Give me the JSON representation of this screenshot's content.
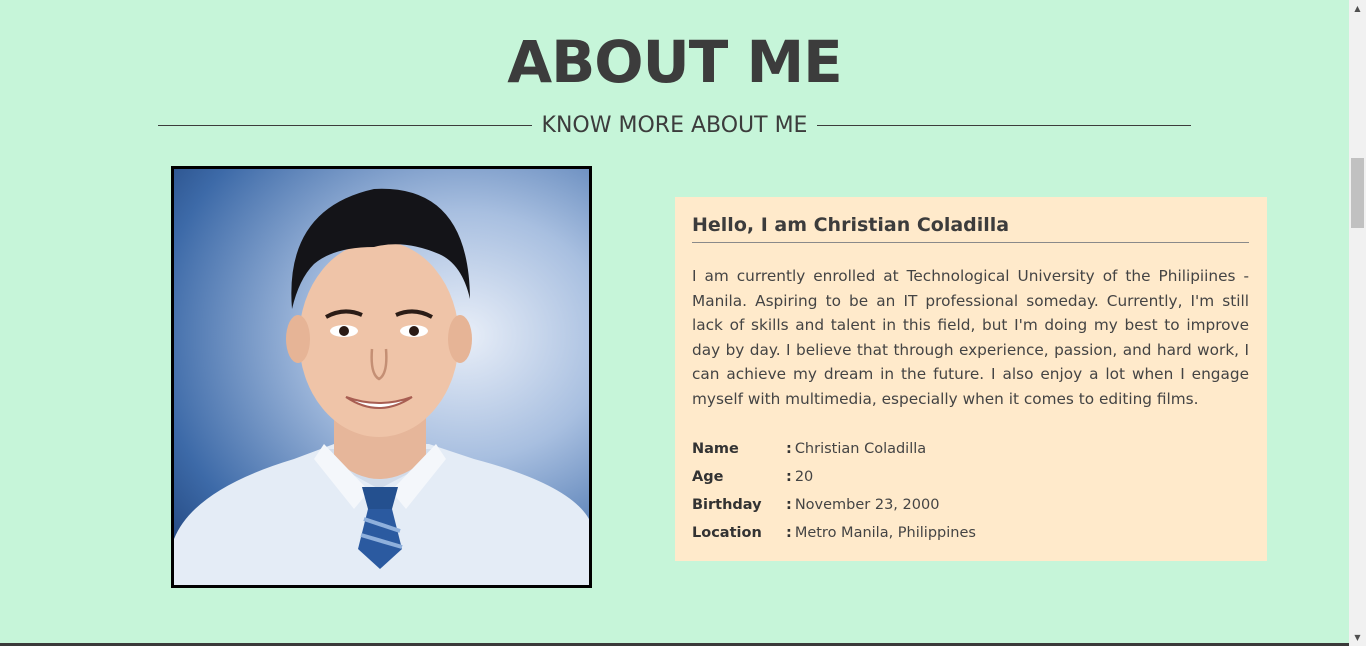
{
  "header": {
    "title": "ABOUT ME",
    "subtitle": "KNOW MORE ABOUT ME"
  },
  "card": {
    "heading": "Hello, I am Christian Coladilla",
    "bio": "I am currently enrolled at Technological University of the Philipiines - Manila. Aspiring to be an IT professional someday. Currently, I'm still lack of skills and talent in this field, but I'm doing my best to improve day by day. I believe that through experience, passion, and hard work, I can achieve my dream in the future. I also enjoy a lot when I engage myself with multimedia, especially when it comes to editing films.",
    "info": [
      {
        "label": "Name",
        "value": "Christian Coladilla"
      },
      {
        "label": "Age",
        "value": "20"
      },
      {
        "label": "Birthday",
        "value": "November 23, 2000"
      },
      {
        "label": "Location",
        "value": "Metro Manila, Philippines"
      }
    ],
    "separator": ":"
  },
  "colors": {
    "background": "#c6f5d9",
    "card": "#ffeacb",
    "text": "#3c3c3c"
  }
}
